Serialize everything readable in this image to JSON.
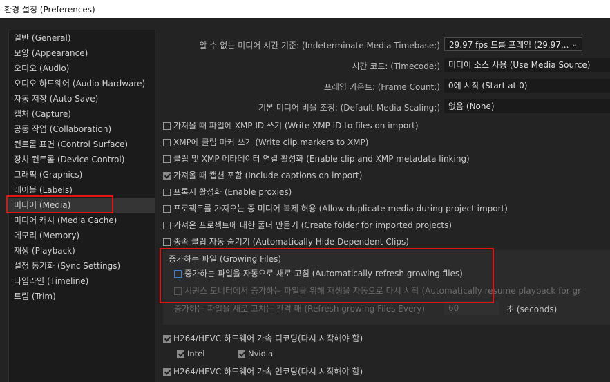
{
  "window": {
    "title": "환경 설정 (Preferences)"
  },
  "sidebar": {
    "items": [
      {
        "label": "일반 (General)"
      },
      {
        "label": "모양 (Appearance)"
      },
      {
        "label": "오디오 (Audio)"
      },
      {
        "label": "오디오 하드웨어 (Audio Hardware)"
      },
      {
        "label": "자동 저장 (Auto Save)"
      },
      {
        "label": "캡처 (Capture)"
      },
      {
        "label": "공동 작업 (Collaboration)"
      },
      {
        "label": "컨트롤 표면 (Control Surface)"
      },
      {
        "label": "장치 컨트롤 (Device Control)"
      },
      {
        "label": "그래픽 (Graphics)"
      },
      {
        "label": "레이블 (Labels)"
      },
      {
        "label": "미디어 (Media)",
        "selected": true
      },
      {
        "label": "미디어 캐시 (Media Cache)"
      },
      {
        "label": "메모리 (Memory)"
      },
      {
        "label": "재생 (Playback)"
      },
      {
        "label": "설정 동기화 (Sync Settings)"
      },
      {
        "label": "타임라인 (Timeline)"
      },
      {
        "label": "트림 (Trim)"
      }
    ]
  },
  "settings": {
    "timebase": {
      "label": "알 수 없는 미디어 시간 기준: (Indeterminate Media Timebase:)",
      "value": "29.97 fps 드롭 프레임 (29.97..."
    },
    "timecode": {
      "label": "시간 코드: (Timecode:)",
      "value": "미디어 소스 사용 (Use Media Source)"
    },
    "frame_count": {
      "label": "프레임 카운트: (Frame Count:)",
      "value": "0에 시작 (Start at 0)"
    },
    "scaling": {
      "label": "기본 미디어 비율 조정: (Default Media Scaling:)",
      "value": "없음 (None)"
    }
  },
  "checkboxes": [
    {
      "label": "가져올 때 파일에 XMP ID 쓰기 (Write XMP ID to files on import)",
      "checked": false
    },
    {
      "label": "XMP에 클립 마커 쓰기 (Write clip markers to XMP)",
      "checked": false
    },
    {
      "label": "클립 및 XMP 메타데이터 연결 활성화 (Enable clip and XMP metadata linking)",
      "checked": false
    },
    {
      "label": "가져올 때 캡션 포함 (Include captions on import)",
      "checked": true
    },
    {
      "label": "프록시 활성화 (Enable proxies)",
      "checked": false
    },
    {
      "label": "프로젝트를 가져오는 중 미디어 복제 허용 (Allow duplicate media during project import)",
      "checked": false
    },
    {
      "label": "가져온 프로젝트에 대한 폴더 만들기 (Create folder for imported projects)",
      "checked": false
    },
    {
      "label": "종속 클립 자동 숨기기 (Automatically Hide Dependent Clips)",
      "checked": false
    }
  ],
  "growing_files": {
    "heading": "증가하는 파일 (Growing Files)",
    "auto_refresh": {
      "label": "증가하는 파일을 자동으로 새로 고침 (Automatically refresh growing files)",
      "checked": false
    },
    "auto_resume": {
      "label": "시퀀스 모니터에서 증가하는 파일을 위해 재생을 자동으로 다시 시작 (Automatically resume playback for gr",
      "checked": false,
      "disabled": true
    },
    "refresh_interval": {
      "label": "증가하는 파일을 새로 고치는 간격 매 (Refresh growing Files Every)",
      "value": "60",
      "unit": "초 (seconds)"
    }
  },
  "hardware": {
    "decode": {
      "label": "H264/HEVC 하드웨어 가속 디코딩(다시 시작해야 함)",
      "checked": true
    },
    "intel": {
      "label": "Intel",
      "checked": true
    },
    "nvidia": {
      "label": "Nvidia",
      "checked": true
    },
    "encode": {
      "label": "H264/HEVC 하드웨어 가속 인코딩(다시 시작해야 함)",
      "checked": true
    }
  }
}
